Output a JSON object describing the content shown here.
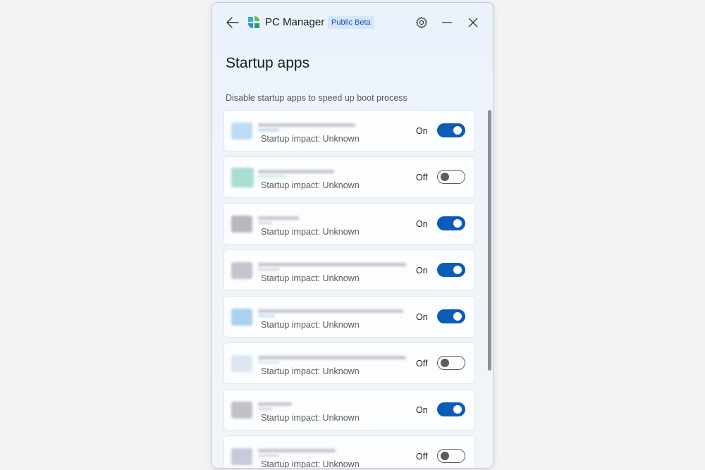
{
  "titlebar": {
    "app_name": "PC Manager",
    "badge": "Public Beta",
    "icons": [
      "back-arrow-icon",
      "pc-manager-logo-icon",
      "gear-icon",
      "minimize-icon",
      "close-icon"
    ]
  },
  "page": {
    "title": "Startup apps",
    "subtitle": "Disable startup apps to speed up boot process"
  },
  "colors": {
    "accent": "#0b5cb8",
    "badge_bg": "#d6e6f8",
    "badge_text": "#0b57b8"
  },
  "apps": [
    {
      "impact": "Startup impact: Unknown",
      "state": "On",
      "enabled": true
    },
    {
      "impact": "Startup impact: Unknown",
      "state": "Off",
      "enabled": false
    },
    {
      "impact": "Startup impact: Unknown",
      "state": "On",
      "enabled": true
    },
    {
      "impact": "Startup impact: Unknown",
      "state": "On",
      "enabled": true
    },
    {
      "impact": "Startup impact: Unknown",
      "state": "On",
      "enabled": true
    },
    {
      "impact": "Startup impact: Unknown",
      "state": "Off",
      "enabled": false
    },
    {
      "impact": "Startup impact: Unknown",
      "state": "On",
      "enabled": true
    },
    {
      "impact": "Startup impact: Unknown",
      "state": "Off",
      "enabled": false
    }
  ]
}
